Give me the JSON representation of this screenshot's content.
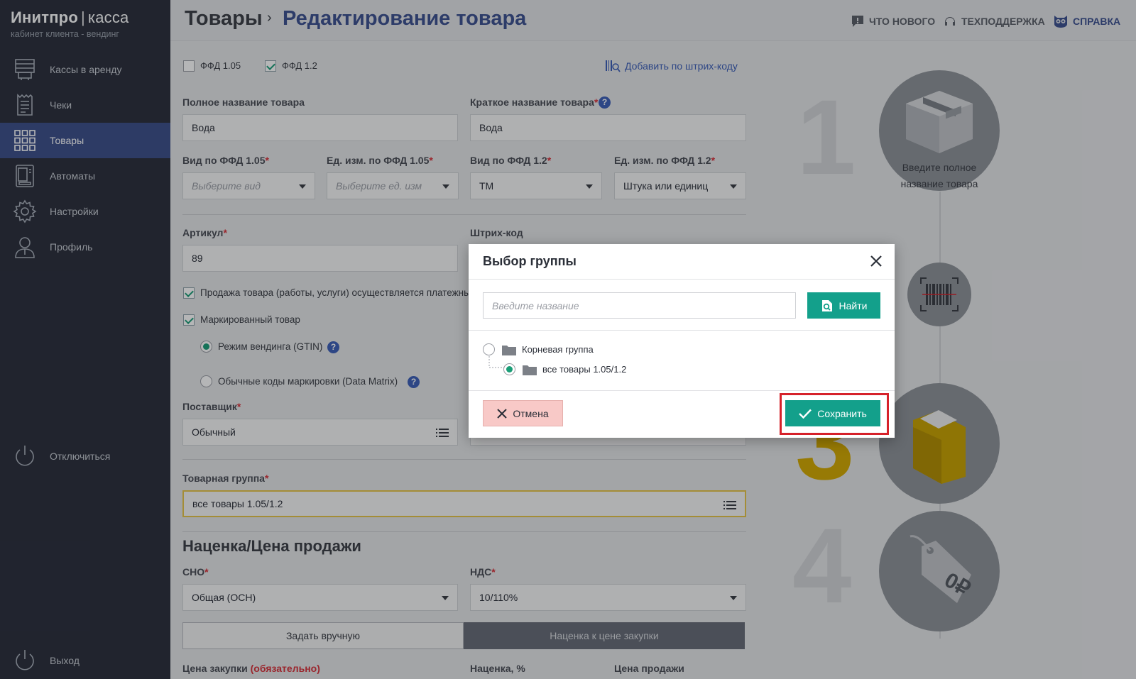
{
  "brand": {
    "name": "Инитпро",
    "separator": "|",
    "product": "касса",
    "subtitle": "кабинет клиента - вендинг"
  },
  "sidebar": {
    "items": [
      {
        "label": "Кассы в аренду",
        "icon": "server-icon"
      },
      {
        "label": "Чеки",
        "icon": "receipt-icon"
      },
      {
        "label": "Товары",
        "icon": "grid-icon",
        "active": true
      },
      {
        "label": "Автоматы",
        "icon": "vending-machine-icon"
      },
      {
        "label": "Настройки",
        "icon": "gear-icon"
      },
      {
        "label": "Профиль",
        "icon": "user-icon"
      }
    ],
    "disconnect": "Отключиться",
    "logout": "Выход"
  },
  "header": {
    "breadcrumb_root": "Товары",
    "breadcrumb_sep": "›",
    "breadcrumb_current": "Редактирование товара",
    "links": {
      "whats_new": "ЧТО НОВОГО",
      "support": "ТЕХПОДДЕРЖКА",
      "help": "СПРАВКА"
    }
  },
  "form": {
    "ffd105": {
      "label": "ФФД 1.05",
      "checked": false
    },
    "ffd12": {
      "label": "ФФД 1.2",
      "checked": true
    },
    "add_by_barcode": "Добавить по штрих-коду",
    "full_name": {
      "label": "Полное название товара",
      "value": "Вода"
    },
    "short_name": {
      "label": "Краткое название товара",
      "required": "*",
      "value": "Вода",
      "help": "?"
    },
    "kind_105": {
      "label": "Вид по ФФД 1.05",
      "required": "*",
      "placeholder": "Выберите вид"
    },
    "unit_105": {
      "label": "Ед. изм. по ФФД 1.05",
      "required": "*",
      "placeholder": "Выберите ед. изм"
    },
    "kind_12": {
      "label": "Вид по ФФД 1.2",
      "required": "*",
      "value": "ТМ"
    },
    "unit_12": {
      "label": "Ед. изм. по ФФД 1.2",
      "required": "*",
      "value": "Штука или единиц"
    },
    "article": {
      "label": "Артикул",
      "required": "*",
      "value": "89"
    },
    "barcode": {
      "label": "Штрих-код"
    },
    "payment_agent": {
      "label": "Продажа товара (работы, услуги) осуществляется платежны",
      "checked": true
    },
    "marked": {
      "label": "Маркированный товар",
      "checked": true
    },
    "mode_vending": {
      "label": "Режим вендинга (GTIN)",
      "checked": true,
      "help": "?"
    },
    "mode_datamatrix": {
      "label": "Обычные коды маркировки (Data Matrix)",
      "checked": false,
      "help": "?"
    },
    "supplier": {
      "label": "Поставщик",
      "required": "*",
      "value": "Обычный"
    },
    "product_group": {
      "label": "Товарная группа",
      "required": "*",
      "value": "все товары 1.05/1.2"
    },
    "section_title": "Наценка/Цена продажи",
    "sno": {
      "label": "СНО",
      "required": "*",
      "value": "Общая (ОСН)"
    },
    "nds": {
      "label": "НДС",
      "required": "*",
      "value": "10/110%"
    },
    "tab_manual": "Задать вручную",
    "tab_markup": "Наценка к цене закупки",
    "purchase_price": {
      "label": "Цена закупки",
      "note": "(обязательно)"
    },
    "markup_label": "Наценка, %",
    "sale_price_label": "Цена продажи"
  },
  "steps": {
    "n1": "1",
    "n3": "3",
    "n4": "4",
    "hint": "Введите полное название товара"
  },
  "modal": {
    "title": "Выбор группы",
    "search_placeholder": "Введите название",
    "find_label": "Найти",
    "tree": [
      {
        "label": "Корневая группа",
        "selected": false
      },
      {
        "label": "все товары 1.05/1.2",
        "selected": true
      }
    ],
    "cancel_label": "Отмена",
    "save_label": "Сохранить"
  },
  "colors": {
    "accent": "#13a08b",
    "sidebar": "#2b2f3b",
    "active": "#3d4f8a",
    "brand_blue": "#3d5190",
    "highlight": "#d6212a"
  }
}
